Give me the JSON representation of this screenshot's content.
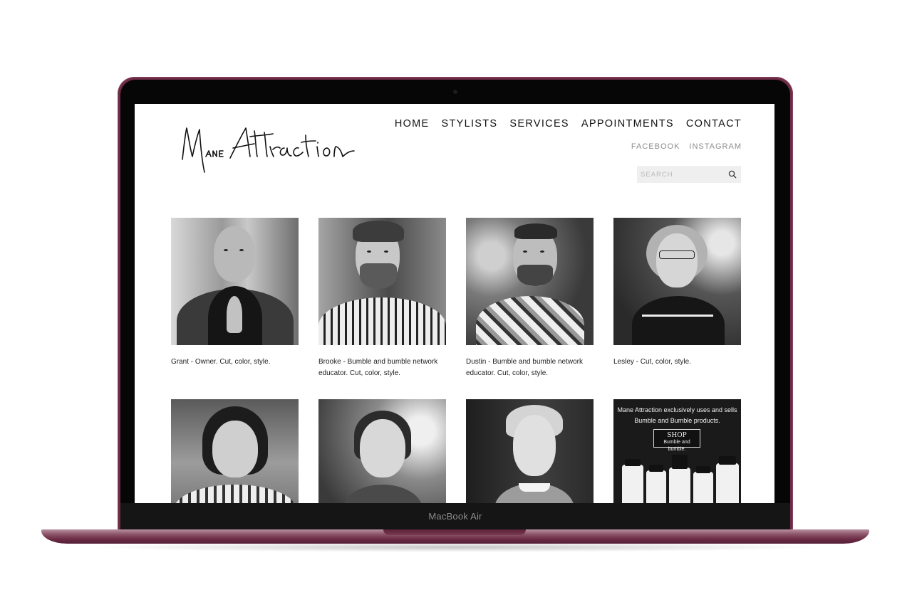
{
  "device": {
    "label": "MacBook Air"
  },
  "site": {
    "logo_text": "Mane Attraction",
    "nav": [
      "HOME",
      "STYLISTS",
      "SERVICES",
      "APPOINTMENTS",
      "CONTACT"
    ],
    "social": [
      "FACEBOOK",
      "INSTAGRAM"
    ],
    "search": {
      "placeholder": "SEARCH",
      "value": ""
    }
  },
  "stylists": [
    {
      "caption": "Grant - Owner. Cut, color, style."
    },
    {
      "caption": "Brooke - Bumble and bumble network educator. Cut, color, style."
    },
    {
      "caption": "Dustin - Bumble and bumble network educator. Cut, color, style."
    },
    {
      "caption": "Lesley - Cut, color, style."
    }
  ],
  "promo": {
    "text": "Mane Attraction exclusively uses and sells Bumble and Bumble products.",
    "badge_title": "SHOP",
    "badge_sub": "Bumble and bumble."
  }
}
